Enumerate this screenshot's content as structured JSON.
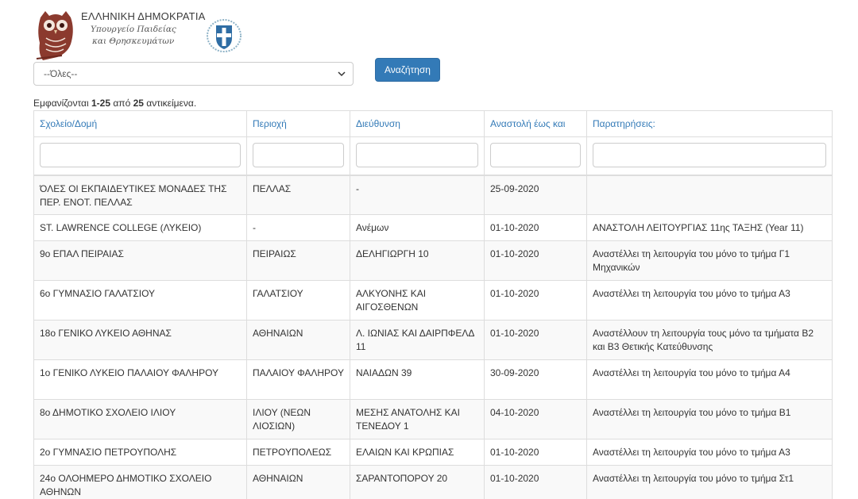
{
  "header": {
    "country": "ΕΛΛΗΝΙΚΗ ΔΗΜΟΚΡΑΤΙΑ",
    "ministry_line1": "Υπουργείο Παιδείας",
    "ministry_line2": "και Θρησκευμάτων"
  },
  "filter": {
    "selected": "--Όλες--",
    "search_label": "Αναζήτηση"
  },
  "summary": {
    "prefix": "Εμφανίζονται ",
    "range": "1-25",
    "middle": " από ",
    "total": "25",
    "suffix": " αντικείμενα."
  },
  "table": {
    "columns": [
      "Σχολείο/Δομή",
      "Περιοχή",
      "Διεύθυνση",
      "Αναστολή έως και",
      "Παρατηρήσεις:"
    ],
    "rows": [
      [
        "ΌΛΕΣ ΟΙ ΕΚΠΑΙΔΕΥΤΙΚΕΣ ΜΟΝΑΔΕΣ ΤΗΣ ΠΕΡ. ΕΝΟΤ. ΠΕΛΛΑΣ",
        "ΠΕΛΛΑΣ",
        "-",
        "25-09-2020",
        ""
      ],
      [
        "ST. LAWRENCE COLLEGE (ΛΥΚΕΙΟ)",
        "-",
        "Ανέμων",
        "01-10-2020",
        "ΑΝΑΣΤΟΛΗ ΛΕΙΤΟΥΡΓΙΑΣ 11ης ΤΑΞΗΣ (Year 11)"
      ],
      [
        "9ο ΕΠΑΛ ΠΕΙΡΑΙΑΣ",
        "ΠΕΙΡΑΙΩΣ",
        "ΔΕΛΗΓΙΩΡΓΗ 10",
        "01-10-2020",
        "Αναστέλλει τη λειτουργία του μόνο το τμήμα Γ1 Μηχανικών"
      ],
      [
        "6ο ΓΥΜΝΑΣΙΟ ΓΑΛΑΤΣΙΟΥ",
        "ΓΑΛΑΤΣΙΟΥ",
        "ΑΛΚΥΟΝΗΣ ΚΑΙ ΑΙΓΟΣΘΕΝΩΝ",
        "01-10-2020",
        "Αναστέλλει τη λειτουργία του μόνο το τμήμα Α3"
      ],
      [
        "18ο ΓΕΝΙΚΟ ΛΥΚΕΙΟ ΑΘΗΝΑΣ",
        "ΑΘΗΝΑΙΩΝ",
        "Λ. ΙΩΝΙΑΣ ΚΑΙ ΔΑΙΡΠΦΕΛΔ 11",
        "01-10-2020",
        "Αναστέλλουν τη λειτουργία τους μόνο τα τμήματα Β2 και Β3 Θετικής Κατεύθυνσης"
      ],
      [
        "1ο ΓΕΝΙΚΟ ΛΥΚΕΙΟ ΠΑΛΑΙΟΥ ΦΑΛΗΡΟΥ",
        "ΠΑΛΑΙΟΥ ΦΑΛΗΡΟΥ",
        "ΝΑΙΑΔΩΝ 39",
        "30-09-2020",
        "Αναστέλλει τη λειτουργία του μόνο το τμήμα Α4"
      ],
      [
        "8ο ΔΗΜΟΤΙΚΟ ΣΧΟΛΕΙΟ ΙΛΙΟΥ",
        "ΙΛΙΟΥ (ΝΕΩΝ ΛΙΟΣΙΩΝ)",
        "ΜΕΣΗΣ ΑΝΑΤΟΛΗΣ ΚΑΙ ΤΕΝΕΔΟΥ 1",
        "04-10-2020",
        "Αναστέλλει τη λειτουργία του μόνο το τμήμα Β1"
      ],
      [
        "2ο ΓΥΜΝΑΣΙΟ ΠΕΤΡΟΥΠΟΛΗΣ",
        "ΠΕΤΡΟΥΠΟΛΕΩΣ",
        "ΕΛΑΙΩΝ ΚΑΙ ΚΡΩΠΙΑΣ",
        "01-10-2020",
        "Αναστέλλει τη λειτουργία του μόνο το τμήμα Α3"
      ],
      [
        "24ο ΟΛΟΗΜΕΡΟ ΔΗΜΟΤΙΚΟ ΣΧΟΛΕΙΟ ΑΘΗΝΩΝ",
        "ΑΘΗΝΑΙΩΝ",
        "ΣΑΡΑΝΤΟΠΟΡΟΥ 20",
        "01-10-2020",
        "Αναστέλλει τη λειτουργία του μόνο το τμήμα Στ1"
      ]
    ]
  },
  "icons": {
    "owl": "owl-logo-icon",
    "emblem": "greek-emblem-icon",
    "caret": "chevron-down-icon"
  },
  "colors": {
    "link": "#337ab7",
    "button": "#337ab7",
    "owl": "#8b3a2e"
  }
}
